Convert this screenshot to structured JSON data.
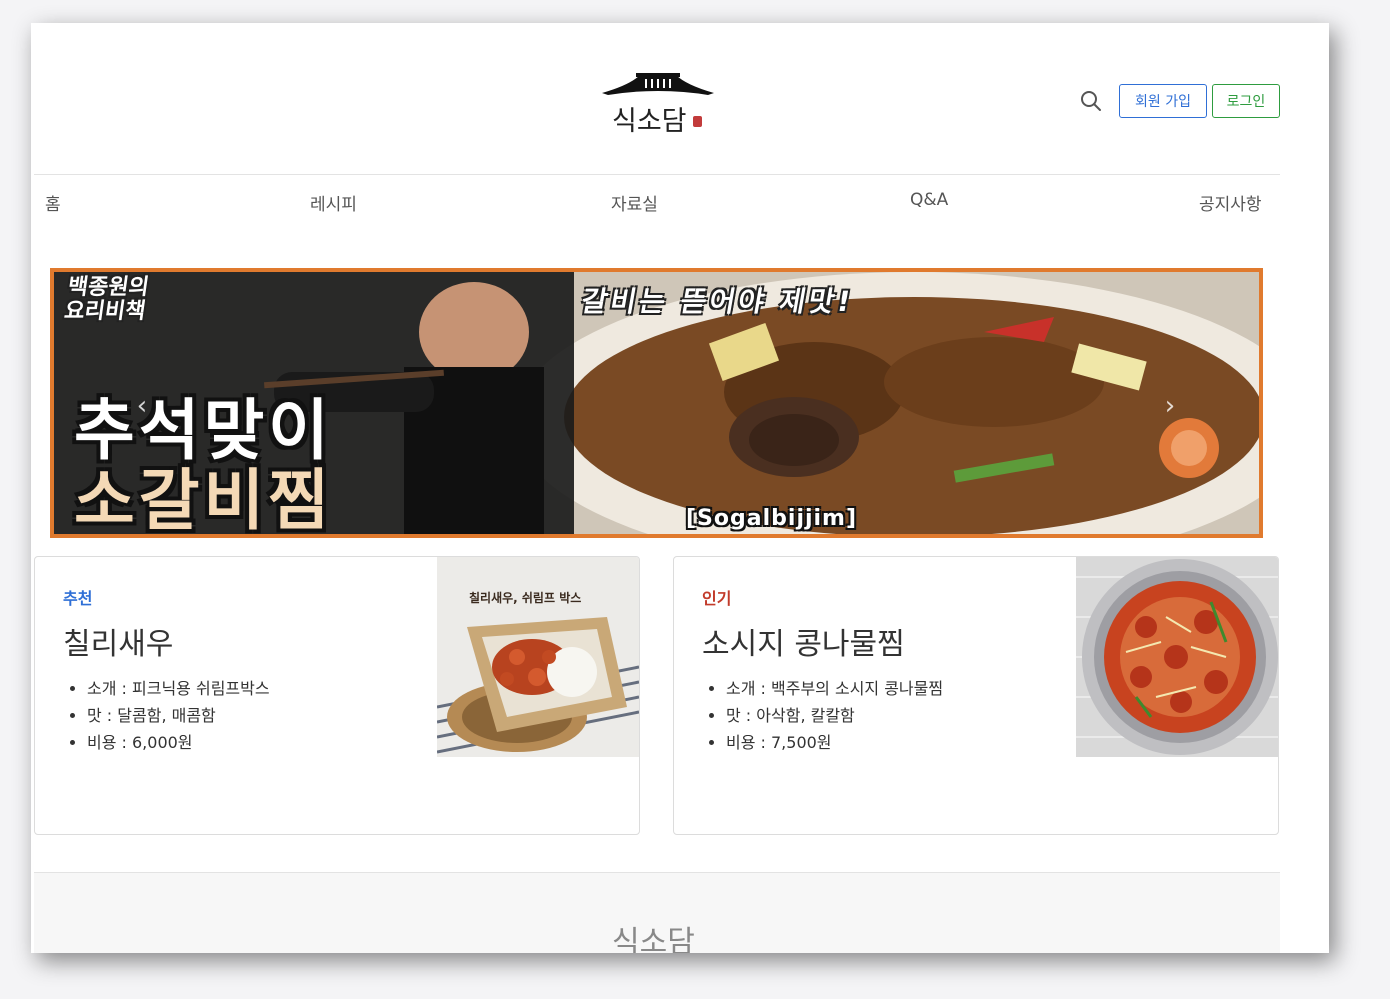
{
  "header": {
    "logo_text": "식소담",
    "signup_label": "회원 가입",
    "login_label": "로그인"
  },
  "nav": {
    "items": [
      {
        "label": "홈"
      },
      {
        "label": "레시피"
      },
      {
        "label": "자료실"
      },
      {
        "label": "Q&A"
      },
      {
        "label": "공지사항"
      }
    ]
  },
  "banner": {
    "badge_line1": "백종원의",
    "badge_line2": "요리비책",
    "top_text": "갈비는 뜯어야 제맛!",
    "headline_line1": "추석맞이",
    "headline_line2": "소갈비찜",
    "subtitle": "[Sogalbijjim]"
  },
  "cards": [
    {
      "tag": "추천",
      "tag_color": "#2f6fd6",
      "title": "칠리새우",
      "image_caption": "칠리새우, 쉬림프 박스",
      "details": [
        "소개 : 피크닉용 쉬림프박스",
        "맛 : 달콤함, 매콤함",
        "비용 : 6,000원"
      ]
    },
    {
      "tag": "인기",
      "tag_color": "#c23b2a",
      "title": "소시지 콩나물찜",
      "details": [
        "소개 : 백주부의 소시지 콩나물찜",
        "맛 : 아삭함, 칼칼함",
        "비용 : 7,500원"
      ]
    }
  ],
  "footer": {
    "title": "식소담"
  },
  "colors": {
    "banner_border": "#e07a2e",
    "signup_blue": "#2f6fd6",
    "login_green": "#2e9c3f"
  }
}
